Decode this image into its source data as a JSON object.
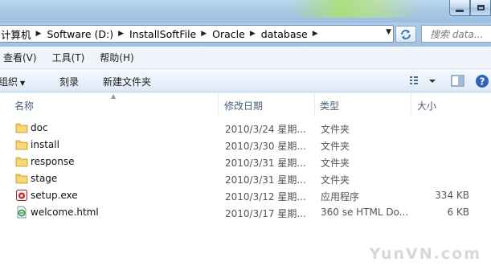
{
  "address": {
    "crumbs": [
      "计算机",
      "Software (D:)",
      "InstallSoftFile",
      "Oracle",
      "database"
    ],
    "search_placeholder": "搜索 data..."
  },
  "menu": [
    "查看(V)",
    "工具(T)",
    "帮助(H)"
  ],
  "toolbar": {
    "organize": "组织",
    "burn": "刻录",
    "new_folder": "新建文件夹"
  },
  "columns": {
    "name": "名称",
    "date": "修改日期",
    "type": "类型",
    "size": "大小"
  },
  "files": [
    {
      "name": "doc",
      "date": "2010/3/24 星期...",
      "type": "文件夹",
      "size": "",
      "icon": "folder-icon"
    },
    {
      "name": "install",
      "date": "2010/3/30 星期...",
      "type": "文件夹",
      "size": "",
      "icon": "folder-icon"
    },
    {
      "name": "response",
      "date": "2010/3/31 星期...",
      "type": "文件夹",
      "size": "",
      "icon": "folder-icon"
    },
    {
      "name": "stage",
      "date": "2010/3/31 星期...",
      "type": "文件夹",
      "size": "",
      "icon": "folder-icon"
    },
    {
      "name": "setup.exe",
      "date": "2010/3/12 星期...",
      "type": "应用程序",
      "size": "334 KB",
      "icon": "application-icon"
    },
    {
      "name": "welcome.html",
      "date": "2010/3/17 星期...",
      "type": "360 se HTML Do...",
      "size": "6 KB",
      "icon": "html-file-icon"
    }
  ],
  "watermark": "YunVN.com"
}
